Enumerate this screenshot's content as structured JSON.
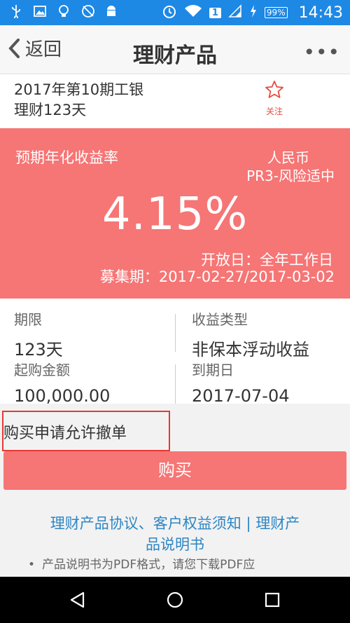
{
  "status_bar": {
    "time": "14:43",
    "battery": "99%",
    "sim": "1",
    "icons": [
      "usb-icon",
      "image-icon",
      "bulb-icon",
      "no-sync-icon",
      "android-icon",
      "alarm-icon",
      "wifi-icon",
      "signal-icon",
      "charging-icon"
    ]
  },
  "header": {
    "back_label": "返回",
    "title": "理财产品",
    "more_label": "•••"
  },
  "product": {
    "name_line1": "2017年第10期工银",
    "name_line2": "理财123天",
    "follow_label": "关注"
  },
  "rate_panel": {
    "label": "预期年化收益率",
    "currency": "人民币",
    "risk": "PR3-风险适中",
    "rate": "4.15%",
    "open_day": "开放日：全年工作日",
    "raise_period": "募集期：2017-02-27/2017-03-02",
    "color": "#f67575"
  },
  "info": {
    "term_label": "期限",
    "term_value": "123天",
    "income_type_label": "收益类型",
    "income_type_value": "非保本浮动收益",
    "min_amount_label": "起购金额",
    "min_amount_value": "100,000.00",
    "maturity_label": "到期日",
    "maturity_value": "2017-07-04"
  },
  "cancel_note": "购买申请允许撤单",
  "buy_button": "购买",
  "links": {
    "line1": "理财产品协议、客户权益须知 | 理财产",
    "line2": "品说明书"
  },
  "note": {
    "bullet": "•",
    "text": "产品说明书为PDF格式，请您下载PDF应"
  }
}
